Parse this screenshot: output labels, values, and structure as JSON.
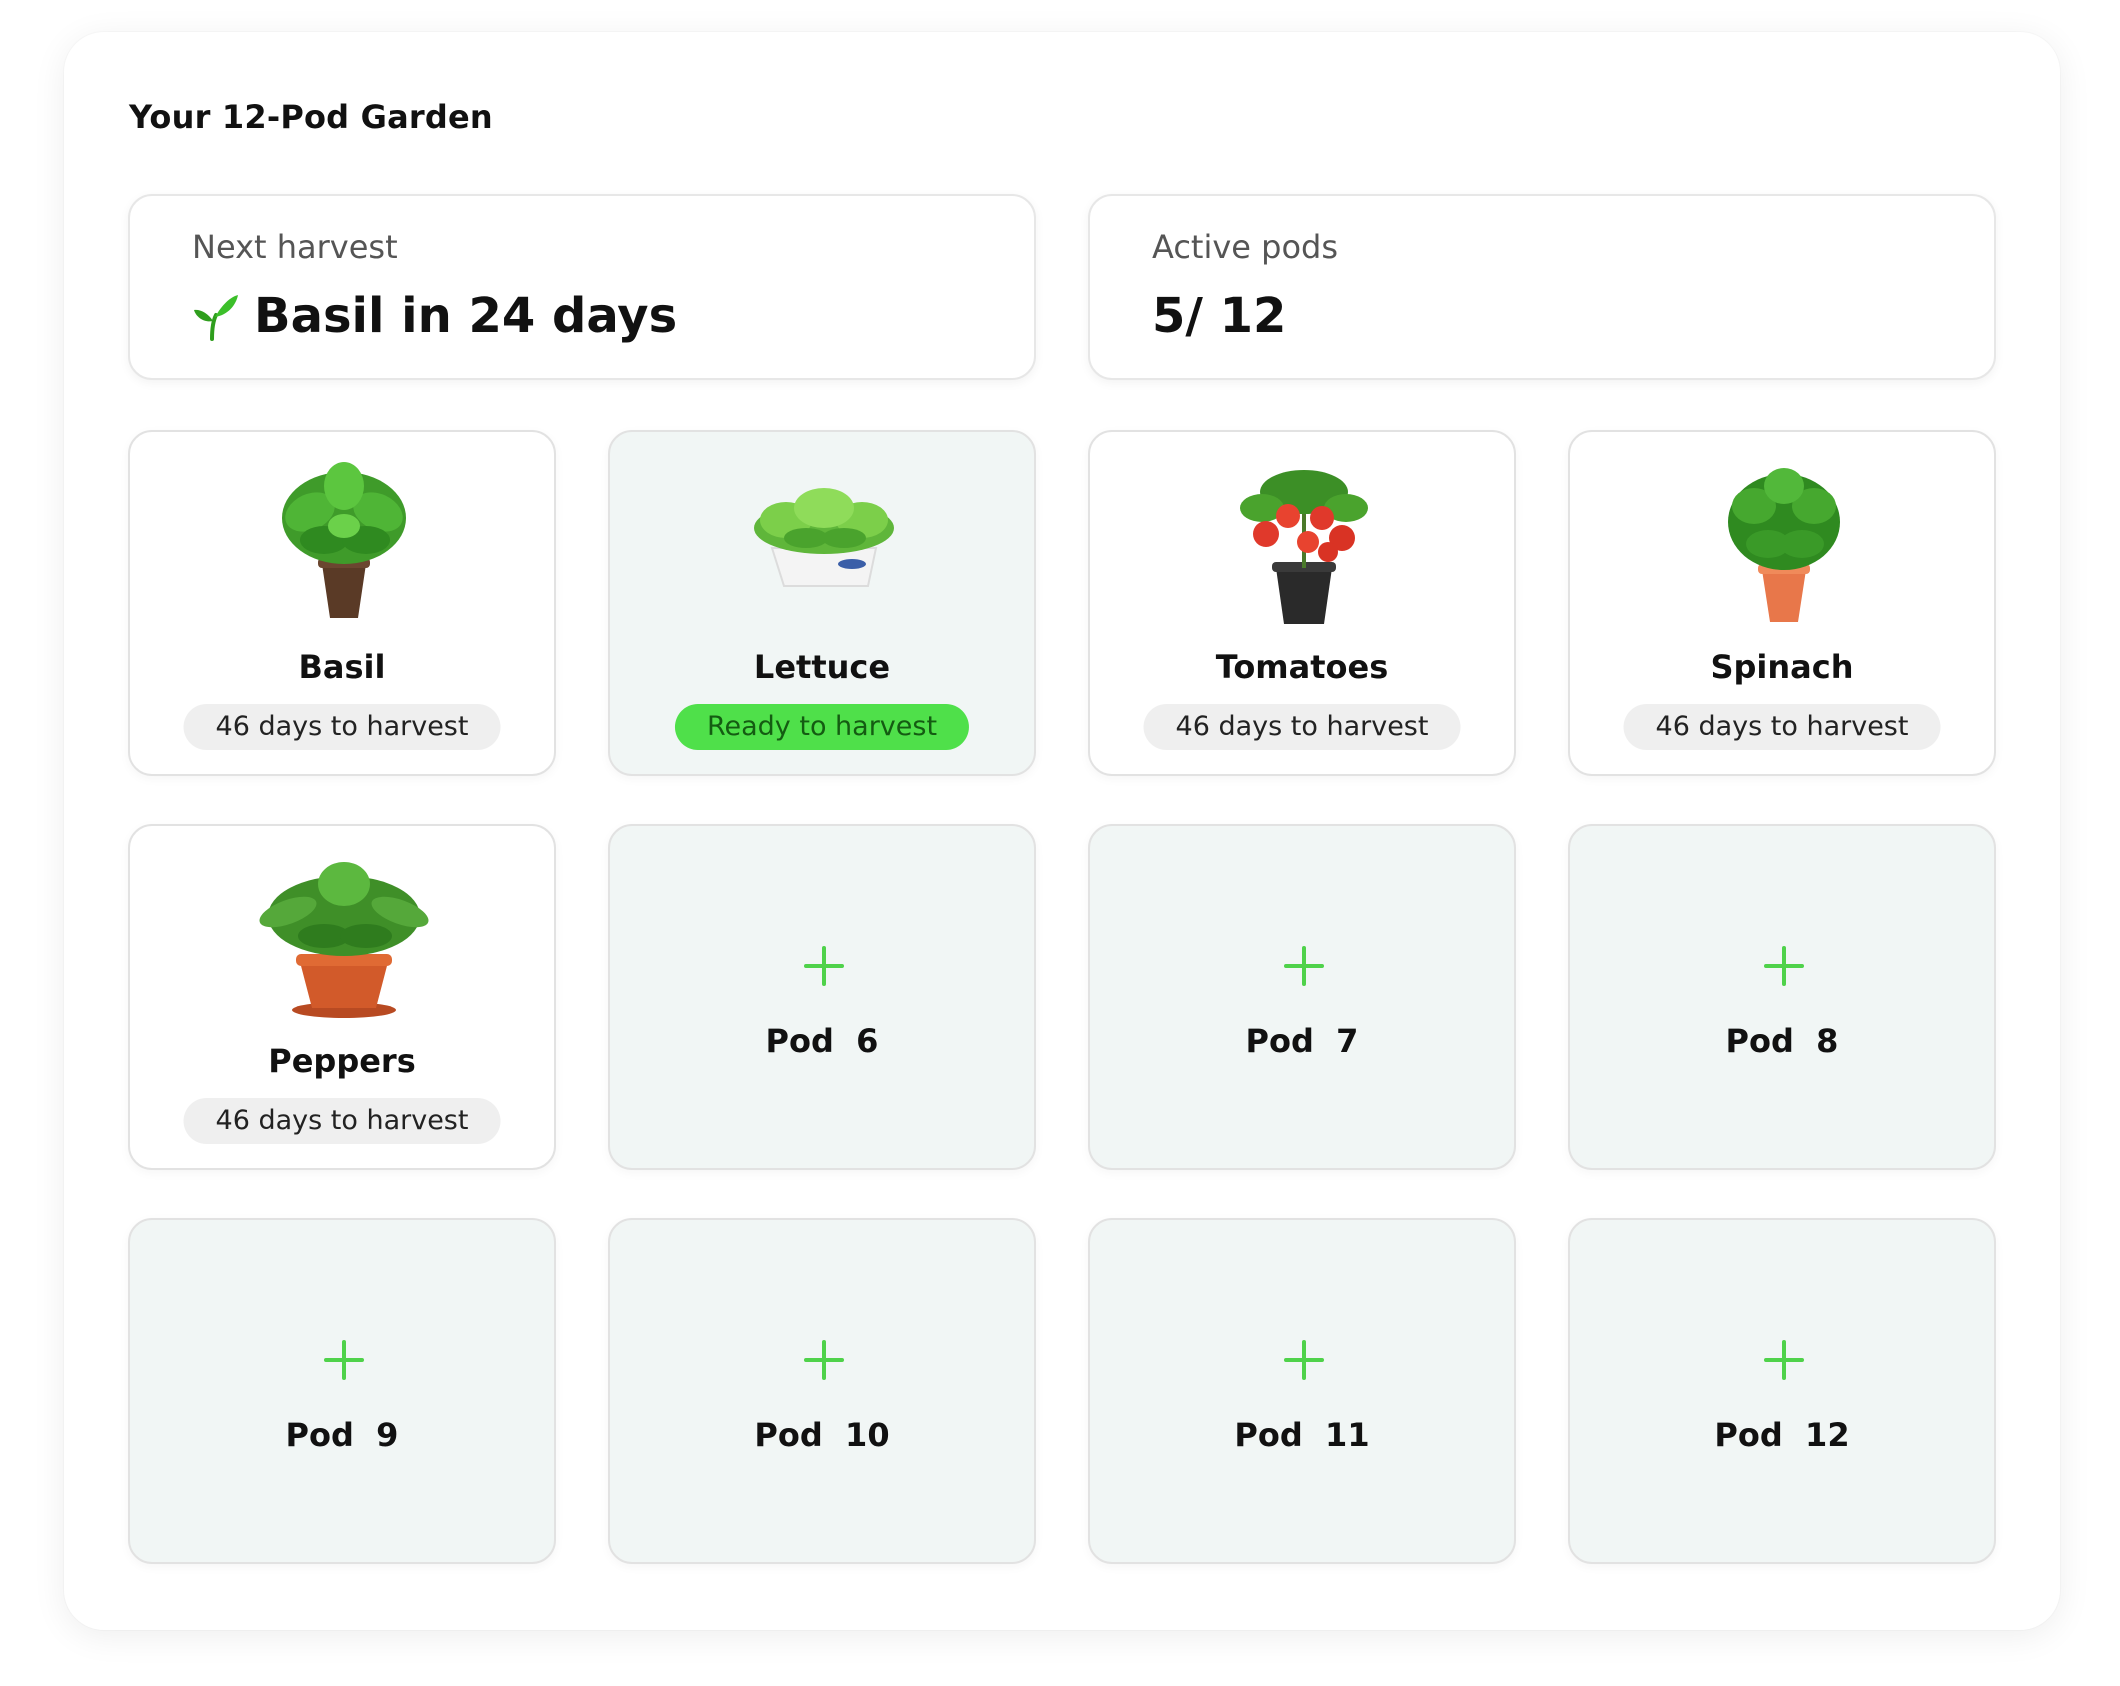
{
  "garden": {
    "title": "Your 12-Pod Garden"
  },
  "stats": {
    "next_harvest": {
      "label": "Next harvest",
      "value": "Basil in 24 days",
      "icon": "sprout-icon"
    },
    "active_pods": {
      "label": "Active pods",
      "value": "5/ 12"
    }
  },
  "pods": {
    "basil": {
      "name": "Basil",
      "status": "46 days to harvest"
    },
    "lettuce": {
      "name": "Lettuce",
      "status": "Ready to harvest"
    },
    "tomatoes": {
      "name": "Tomatoes",
      "status": "46 days to harvest"
    },
    "spinach": {
      "name": "Spinach",
      "status": "46 days to harvest"
    },
    "peppers": {
      "name": "Peppers",
      "status": "46 days to harvest"
    }
  },
  "empty_pods": [
    {
      "label": "Pod  6"
    },
    {
      "label": "Pod  7"
    },
    {
      "label": "Pod  8"
    },
    {
      "label": "Pod  9"
    },
    {
      "label": "Pod  10"
    },
    {
      "label": "Pod  11"
    },
    {
      "label": "Pod  12"
    }
  ],
  "colors": {
    "accent_green": "#4fe04a",
    "empty_pod_bg": "#f1f6f5",
    "status_pill_bg": "#efefef"
  }
}
